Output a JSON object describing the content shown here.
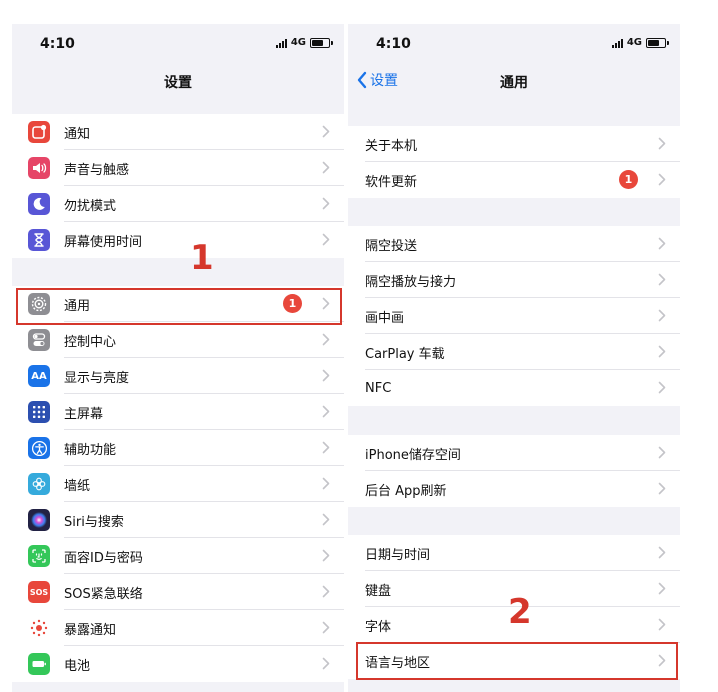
{
  "left_screen": {
    "status": {
      "time": "4:10",
      "network": "4G"
    },
    "nav_title": "设置",
    "group1": [
      {
        "label": "通知",
        "icon": "notifications-icon",
        "color": "#e8473b"
      },
      {
        "label": "声音与触感",
        "icon": "speaker-icon",
        "color": "#e64567"
      },
      {
        "label": "勿扰模式",
        "icon": "moon-icon",
        "color": "#5856d6"
      },
      {
        "label": "屏幕使用时间",
        "icon": "hourglass-icon",
        "color": "#5856d6"
      }
    ],
    "group2": [
      {
        "label": "通用",
        "icon": "gear-icon",
        "color": "#8e8e93",
        "badge": "1"
      },
      {
        "label": "控制中心",
        "icon": "toggles-icon",
        "color": "#8e8e93"
      },
      {
        "label": "显示与亮度",
        "icon": "text-size-icon",
        "color": "#1a73e8",
        "glyph": "AA"
      },
      {
        "label": "主屏幕",
        "icon": "home-grid-icon",
        "color": "#2c4fb0"
      },
      {
        "label": "辅助功能",
        "icon": "accessibility-icon",
        "color": "#1a73e8"
      },
      {
        "label": "墙纸",
        "icon": "flower-icon",
        "color": "#35aadc"
      },
      {
        "label": "Siri与搜索",
        "icon": "siri-icon",
        "color": "#222244"
      },
      {
        "label": "面容ID与密码",
        "icon": "face-id-icon",
        "color": "#34c759"
      },
      {
        "label": "SOS紧急联络",
        "icon": "sos-icon",
        "color": "#e8473b",
        "glyph": "SOS"
      },
      {
        "label": "暴露通知",
        "icon": "exposure-icon",
        "color": "#ffffff"
      },
      {
        "label": "电池",
        "icon": "battery-icon",
        "color": "#34c759"
      }
    ]
  },
  "right_screen": {
    "status": {
      "time": "4:10",
      "network": "4G"
    },
    "back_label": "设置",
    "nav_title": "通用",
    "group1": [
      {
        "label": "关于本机"
      },
      {
        "label": "软件更新",
        "badge": "1"
      }
    ],
    "group2": [
      {
        "label": "隔空投送"
      },
      {
        "label": "隔空播放与接力"
      },
      {
        "label": "画中画"
      },
      {
        "label": "CarPlay 车载"
      },
      {
        "label": "NFC"
      }
    ],
    "group3": [
      {
        "label": "iPhone储存空间"
      },
      {
        "label": "后台 App刷新"
      }
    ],
    "group4": [
      {
        "label": "日期与时间"
      },
      {
        "label": "键盘"
      },
      {
        "label": "字体"
      },
      {
        "label": "语言与地区"
      }
    ]
  },
  "annotations": {
    "step1": "1",
    "step2": "2",
    "highlight_color": "#d5372c"
  }
}
